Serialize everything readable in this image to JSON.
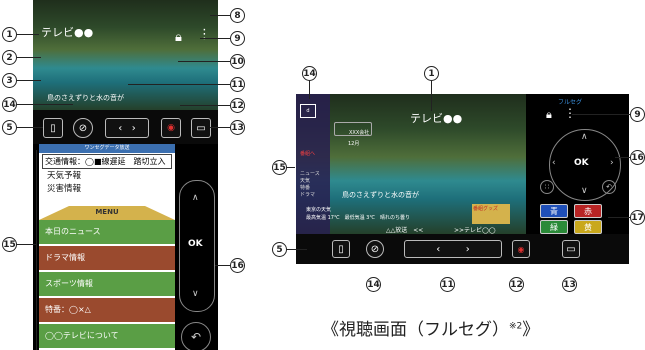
{
  "left": {
    "channel": "テレビ●●",
    "subtitle": "鳥のさえずりと水の音が",
    "data_header": "ワンセグデータ放送",
    "traffic": "交通情報：◯■線遅延　踏切立入",
    "links": [
      "天気予報",
      "災害情報"
    ],
    "menu_label": "MENU",
    "menu_items": [
      "本日のニュース",
      "ドラマ情報",
      "スポーツ情報",
      "特番：◯×△",
      "◯◯テレビについて"
    ],
    "ok_label": "OK"
  },
  "right": {
    "channel": "テレビ●●",
    "subtitle": "鳥のさえずりと水の音が",
    "brand": "フルセグ",
    "epg_line1": "XXX会社",
    "epg_line2": "12月",
    "sidemenu_tag": "番組へ",
    "sidemenu_items": [
      "ニュース",
      "天気",
      "特番",
      "ドラマ"
    ],
    "ticker1": "東京の天気",
    "ticker2": "最高気温 17℃　最低気温 3℃　晴れのち曇り",
    "panel_tag": "番組グッズ",
    "bottom_left": "△△放送　<<",
    "bottom_right": ">>テレビ◯◯",
    "ok_label": "OK",
    "color_buttons": {
      "blue": "青",
      "red": "赤",
      "green": "緑",
      "yellow": "黄"
    }
  },
  "caption": "《視聴画面（フルセグ）",
  "caption_note": "※2",
  "callouts": {
    "n1": "1",
    "n2": "2",
    "n3": "3",
    "n5": "5",
    "n8": "8",
    "n9": "9",
    "n10": "10",
    "n11": "11",
    "n12": "12",
    "n13": "13",
    "n14": "14",
    "n15": "15",
    "n16": "16",
    "n17": "17"
  },
  "colors": {
    "menu_green": "#5a9e45",
    "menu_brown": "#9a4a2e",
    "menu_gold": "#d4b24c",
    "data_blue": "#3b6fb0"
  }
}
